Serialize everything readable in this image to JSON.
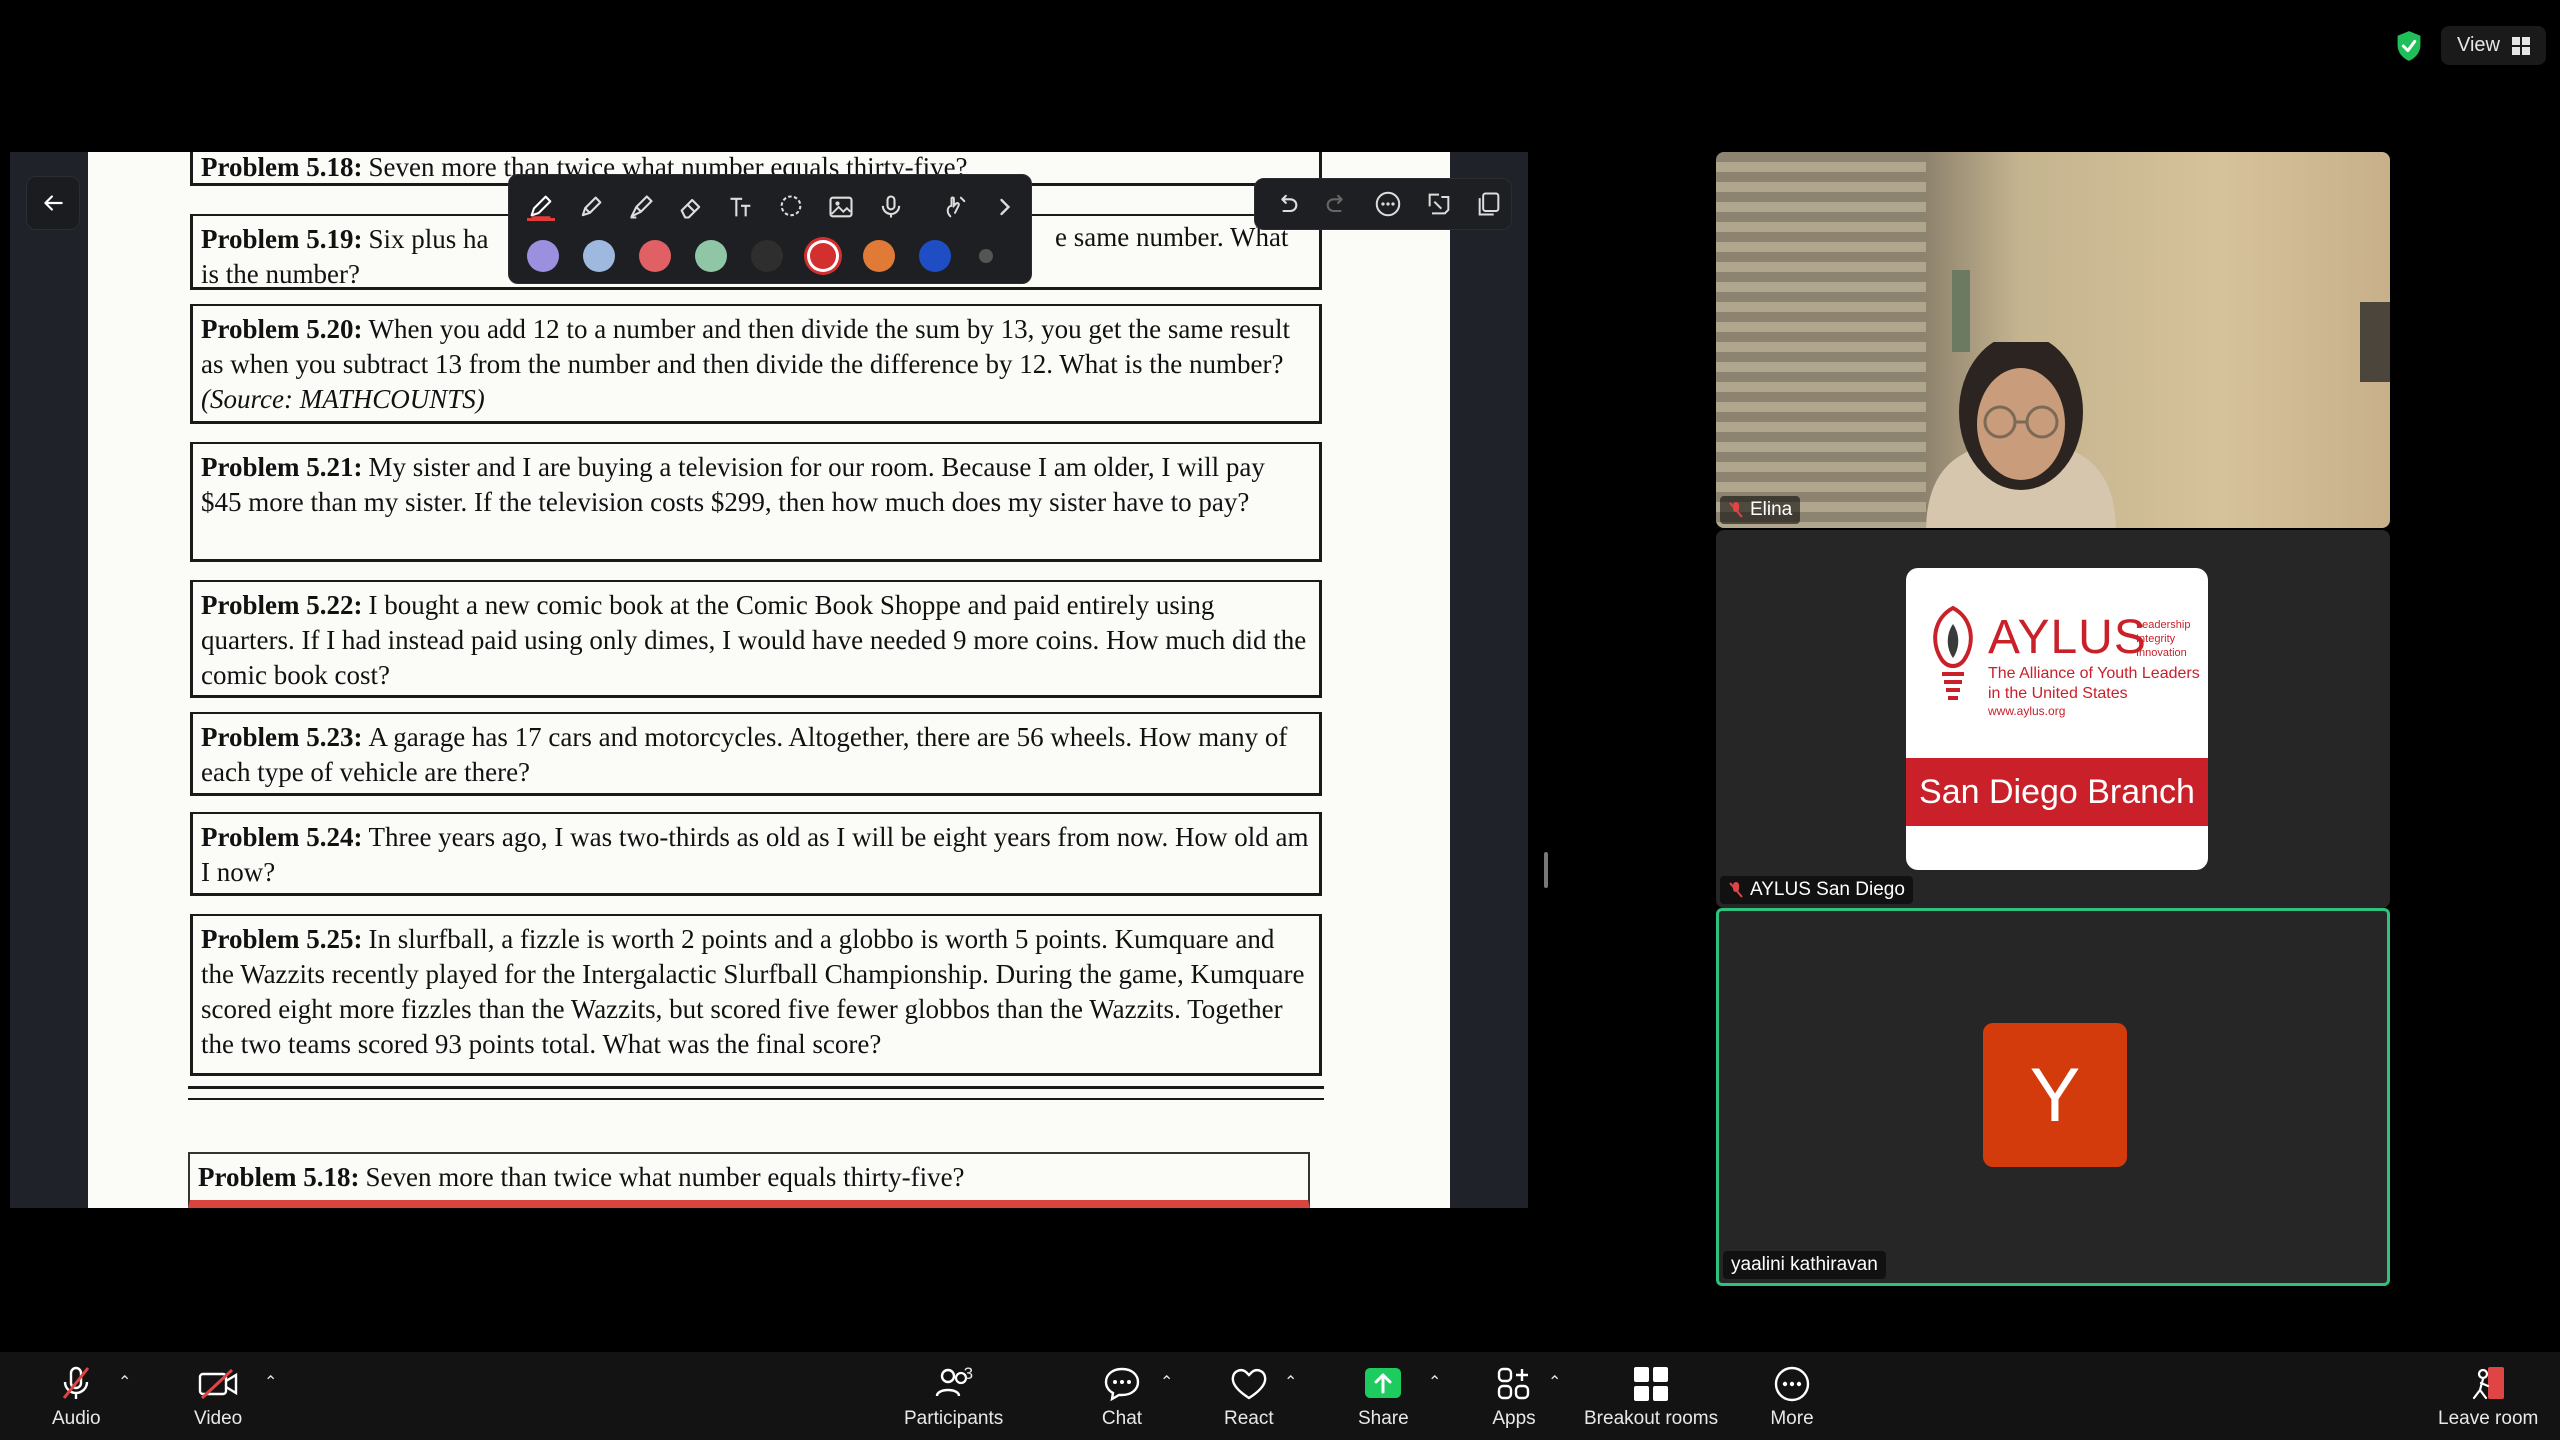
{
  "top": {
    "view_label": "View"
  },
  "document": {
    "problems": [
      {
        "num": "Problem 5.18:",
        "text": "Seven more than twice what number equals thirty-five?"
      },
      {
        "num": "Problem 5.19:",
        "text_left": "Six plus ha",
        "text_right": "e same number.  What",
        "text_line2": "is the number?"
      },
      {
        "num": "Problem 5.20:",
        "text": "When you add 12 to a number and then divide the sum by 13, you get the same result as when you subtract 13 from the number and then divide the difference by 12. What is the number?",
        "source": "(Source: MATHCOUNTS)"
      },
      {
        "num": "Problem 5.21:",
        "text": "My sister and I are buying a television for our room.  Because I am older, I will pay $45 more than my sister.  If the television costs $299, then how much does my sister have to pay?"
      },
      {
        "num": "Problem 5.22:",
        "text": "I bought a new comic book at the Comic Book Shoppe and paid entirely using quarters.  If I had instead paid using only dimes, I would have needed 9 more coins.  How much did the comic book cost?"
      },
      {
        "num": "Problem 5.23:",
        "text": "A garage has 17 cars and motorcycles.  Altogether, there are 56 wheels.  How many of each type of vehicle are there?"
      },
      {
        "num": "Problem 5.24:",
        "text": "Three years ago, I was two-thirds as old as I will be eight years from now. How old am I now?"
      },
      {
        "num": "Problem 5.25:",
        "text": "In slurfball, a fizzle is worth 2 points and a globbo is worth 5 points.  Kumquare and the Wazzits recently played for the Intergalactic Slurfball Championship.  During the game, Kumquare scored eight more fizzles than the Wazzits, but scored five fewer globbos than the Wazzits.  Together the two teams scored 93 points total.  What was the final score?"
      },
      {
        "num": "Problem 5.18:",
        "text": "Seven more than twice what number equals thirty-five?"
      }
    ]
  },
  "annotation": {
    "tools": [
      "pen-icon",
      "highlighter-icon",
      "marker-icon",
      "eraser-icon",
      "text-icon",
      "lasso-icon",
      "image-icon",
      "microphone-icon",
      "gesture-icon",
      "chevron-right-icon"
    ],
    "colors": [
      "#9b8fe0",
      "#9fb8de",
      "#e06065",
      "#8fc7a6",
      "#2e2e2e",
      "#d32f2f",
      "#e07a36",
      "#1f4ec4"
    ],
    "selected_color": "#d32f2f",
    "actions": [
      "undo-icon",
      "redo-icon",
      "more-icon",
      "export-icon",
      "copy-icon"
    ]
  },
  "participants_tiles": [
    {
      "name": "Elina",
      "muted": true
    },
    {
      "name": "AYLUS San Diego",
      "muted": true,
      "logo": {
        "name": "AYLUS",
        "tagline": [
          "Leadership",
          "Integrity",
          "Innovation"
        ],
        "subtitle": [
          "The Alliance of Youth Leaders",
          "in the United States"
        ],
        "url": "www.aylus.org",
        "band": "San Diego Branch"
      }
    },
    {
      "name": "yaalini kathiravan",
      "initial": "Y",
      "active_speaker": true
    }
  ],
  "toolbar": {
    "audio": "Audio",
    "video": "Video",
    "participants": "Participants",
    "participants_count": "3",
    "chat": "Chat",
    "react": "React",
    "share": "Share",
    "apps": "Apps",
    "breakout": "Breakout rooms",
    "more": "More",
    "leave": "Leave room"
  },
  "colors": {
    "accent_green": "#2fc27e",
    "share_green": "#1ecb5f",
    "avatar_orange": "#d33a0c",
    "aylus_red": "#c9202a"
  }
}
